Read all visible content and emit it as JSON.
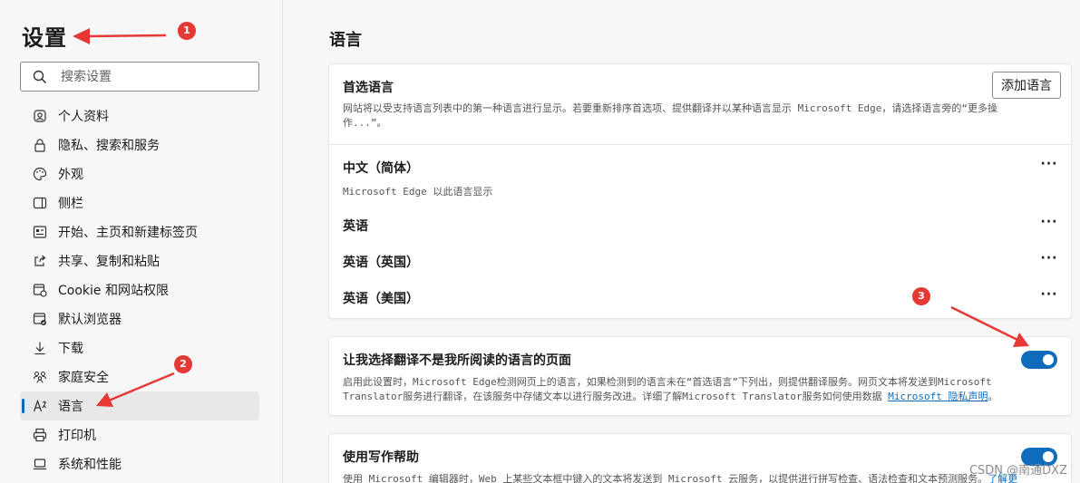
{
  "sidebar": {
    "title": "设置",
    "search_placeholder": "搜索设置",
    "items": [
      {
        "label": "个人资料",
        "icon": "profile-icon"
      },
      {
        "label": "隐私、搜索和服务",
        "icon": "lock-icon"
      },
      {
        "label": "外观",
        "icon": "palette-icon"
      },
      {
        "label": "侧栏",
        "icon": "sidebar-icon"
      },
      {
        "label": "开始、主页和新建标签页",
        "icon": "home-tabs-icon"
      },
      {
        "label": "共享、复制和粘贴",
        "icon": "share-icon"
      },
      {
        "label": "Cookie 和网站权限",
        "icon": "cookie-icon"
      },
      {
        "label": "默认浏览器",
        "icon": "browser-icon"
      },
      {
        "label": "下载",
        "icon": "download-icon"
      },
      {
        "label": "家庭安全",
        "icon": "family-icon"
      },
      {
        "label": "语言",
        "icon": "language-icon",
        "active": true
      },
      {
        "label": "打印机",
        "icon": "printer-icon"
      },
      {
        "label": "系统和性能",
        "icon": "laptop-icon"
      }
    ]
  },
  "main": {
    "title": "语言",
    "preferred": {
      "heading": "首选语言",
      "add_button": "添加语言",
      "desc_line1": "网站将以受支持语言列表中的第一种语言进行显示。若要重新排序首选项、提供翻译并以某种语言显示 Microsoft Edge，请选择语言旁的“更多操",
      "desc_line2": "作...”。",
      "languages": [
        {
          "name": "中文（简体）",
          "sub": "Microsoft Edge 以此语言显示"
        },
        {
          "name": "英语",
          "sub": ""
        },
        {
          "name": "英语（英国）",
          "sub": ""
        },
        {
          "name": "英语（美国）",
          "sub": ""
        }
      ],
      "more_label": "···"
    },
    "translate": {
      "heading": "让我选择翻译不是我所阅读的语言的页面",
      "desc_line1": "启用此设置时，Microsoft Edge检测网页上的语言，如果检测到的语言未在“首选语言”下列出，则提供翻译服务。网页文本将发送到Microsoft",
      "desc_line2_prefix": "Translator服务进行翻译，在该服务中存储文本以进行服务改进。详细了解Microsoft Translator服务如何使用数据 ",
      "desc_link": "Microsoft 隐私声明",
      "desc_line2_suffix": "。",
      "toggle_on": true
    },
    "writing": {
      "heading": "使用写作帮助",
      "desc_line1": "使用 Microsoft 编辑器时，Web 上某些文本框中键入的文本将发送到 Microsoft 云服务，以提供进行拼写检查、语法检查和文本预测服务。",
      "link": "了解更",
      "toggle_on": true
    }
  },
  "annotations": [
    "1",
    "2",
    "3"
  ],
  "watermark": "CSDN @南通DXZ",
  "colors": {
    "accent": "#0f6cbd",
    "annotation": "#e53935"
  }
}
